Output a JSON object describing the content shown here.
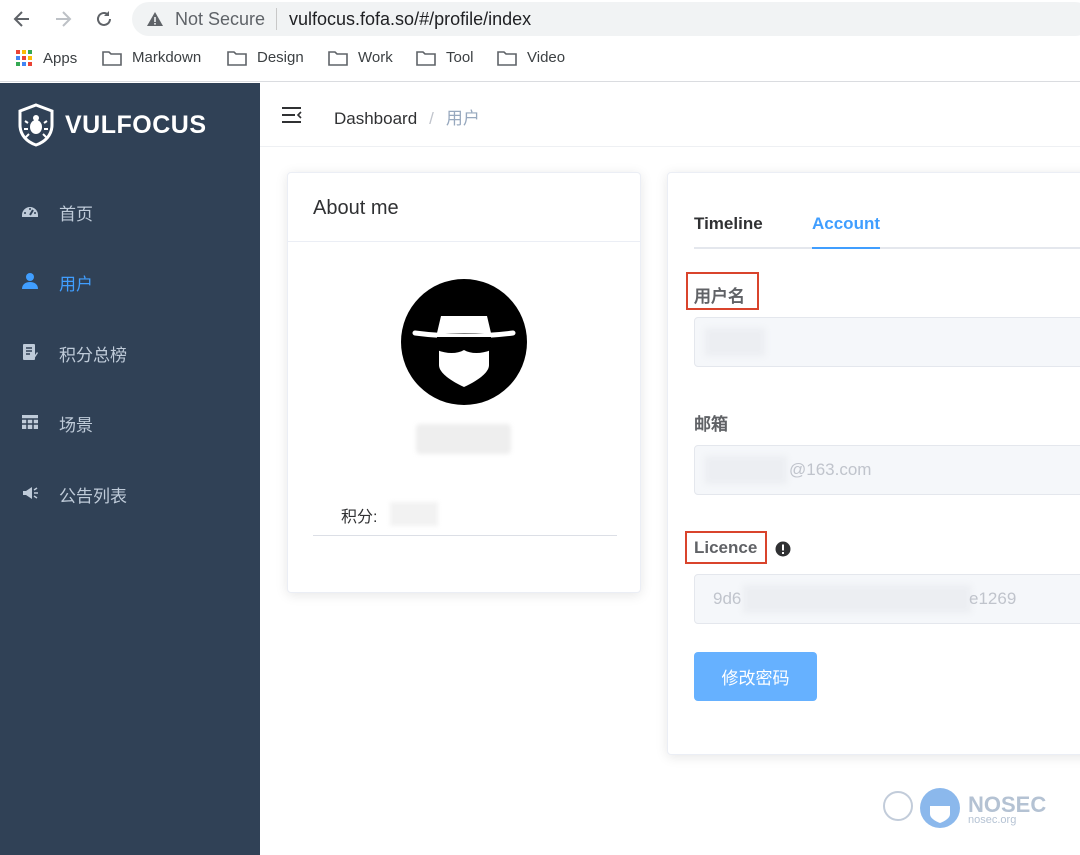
{
  "browser": {
    "security_label": "Not Secure",
    "url": "vulfocus.fofa.so/#/profile/index",
    "bookmarks": [
      "Apps",
      "Markdown",
      "Design",
      "Work",
      "Tool",
      "Video"
    ]
  },
  "sidebar": {
    "logo": "VULFOCUS",
    "items": [
      {
        "label": "首页",
        "icon": "dashboard-icon",
        "active": false
      },
      {
        "label": "用户",
        "icon": "user-icon",
        "active": true
      },
      {
        "label": "积分总榜",
        "icon": "ranking-icon",
        "active": false
      },
      {
        "label": "场景",
        "icon": "grid-icon",
        "active": false
      },
      {
        "label": "公告列表",
        "icon": "megaphone-icon",
        "active": false
      }
    ]
  },
  "breadcrumb": {
    "home": "Dashboard",
    "separator": "/",
    "current": "用户"
  },
  "about": {
    "title": "About me",
    "score_label": "积分:"
  },
  "account": {
    "tabs": [
      "Timeline",
      "Account"
    ],
    "active_tab": "Account",
    "username_label": "用户名",
    "email_label": "邮箱",
    "email_value": "@163.com",
    "licence_label": "Licence",
    "licence_start": "9d6",
    "licence_end": "e1269",
    "change_password_button": "修改密码"
  },
  "watermark": {
    "text": "NOSEC",
    "sub": "nosec.org"
  },
  "colors": {
    "sidebar_bg": "#304156",
    "active": "#409eff",
    "button": "#66b1ff",
    "highlight_box": "#d9442c"
  }
}
